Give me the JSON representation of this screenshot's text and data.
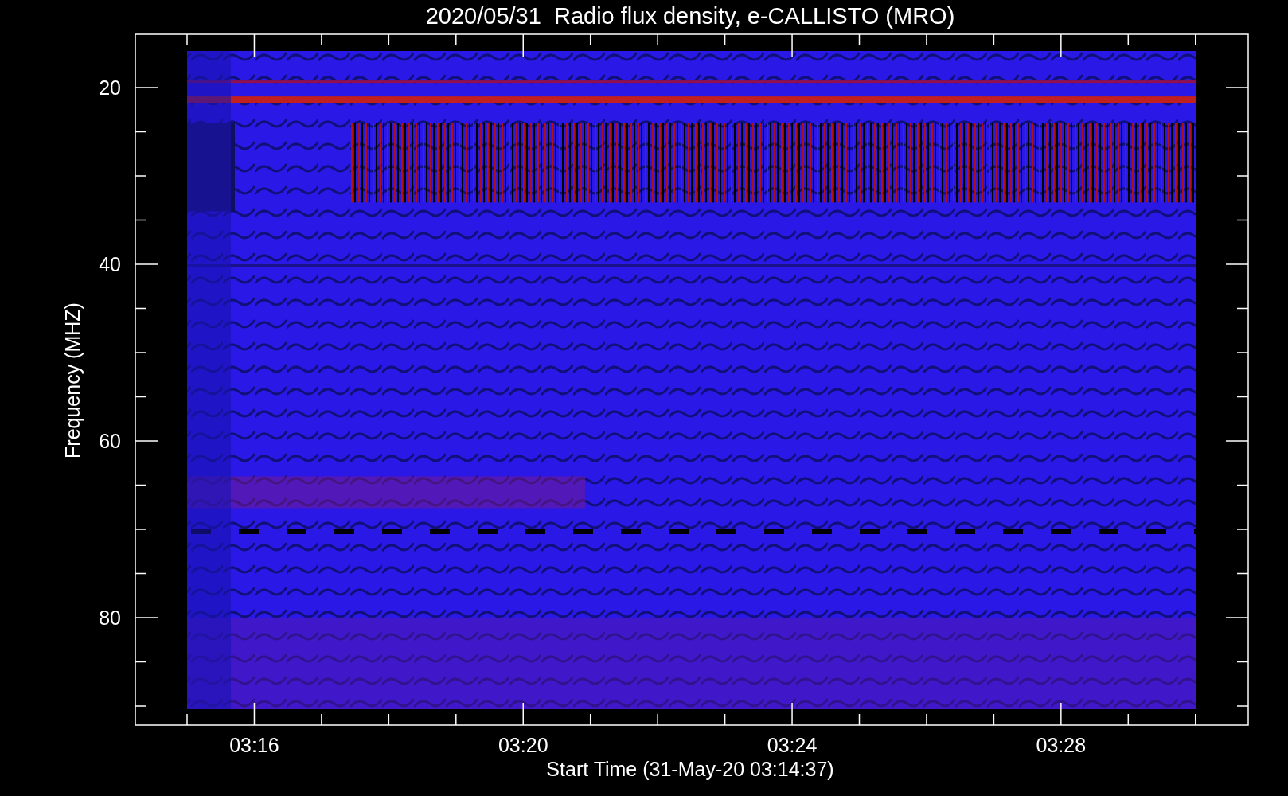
{
  "plot": {
    "title": "2020/05/31  Radio flux density, e-CALLISTO (MRO)",
    "ylabel": "Frequency (MHZ)",
    "xlabel": "Start Time (31-May-20 03:14:37)",
    "yticks": [
      "20",
      "40",
      "60",
      "80"
    ],
    "xticks": [
      "03:16",
      "03:20",
      "03:24",
      "03:28"
    ]
  }
}
